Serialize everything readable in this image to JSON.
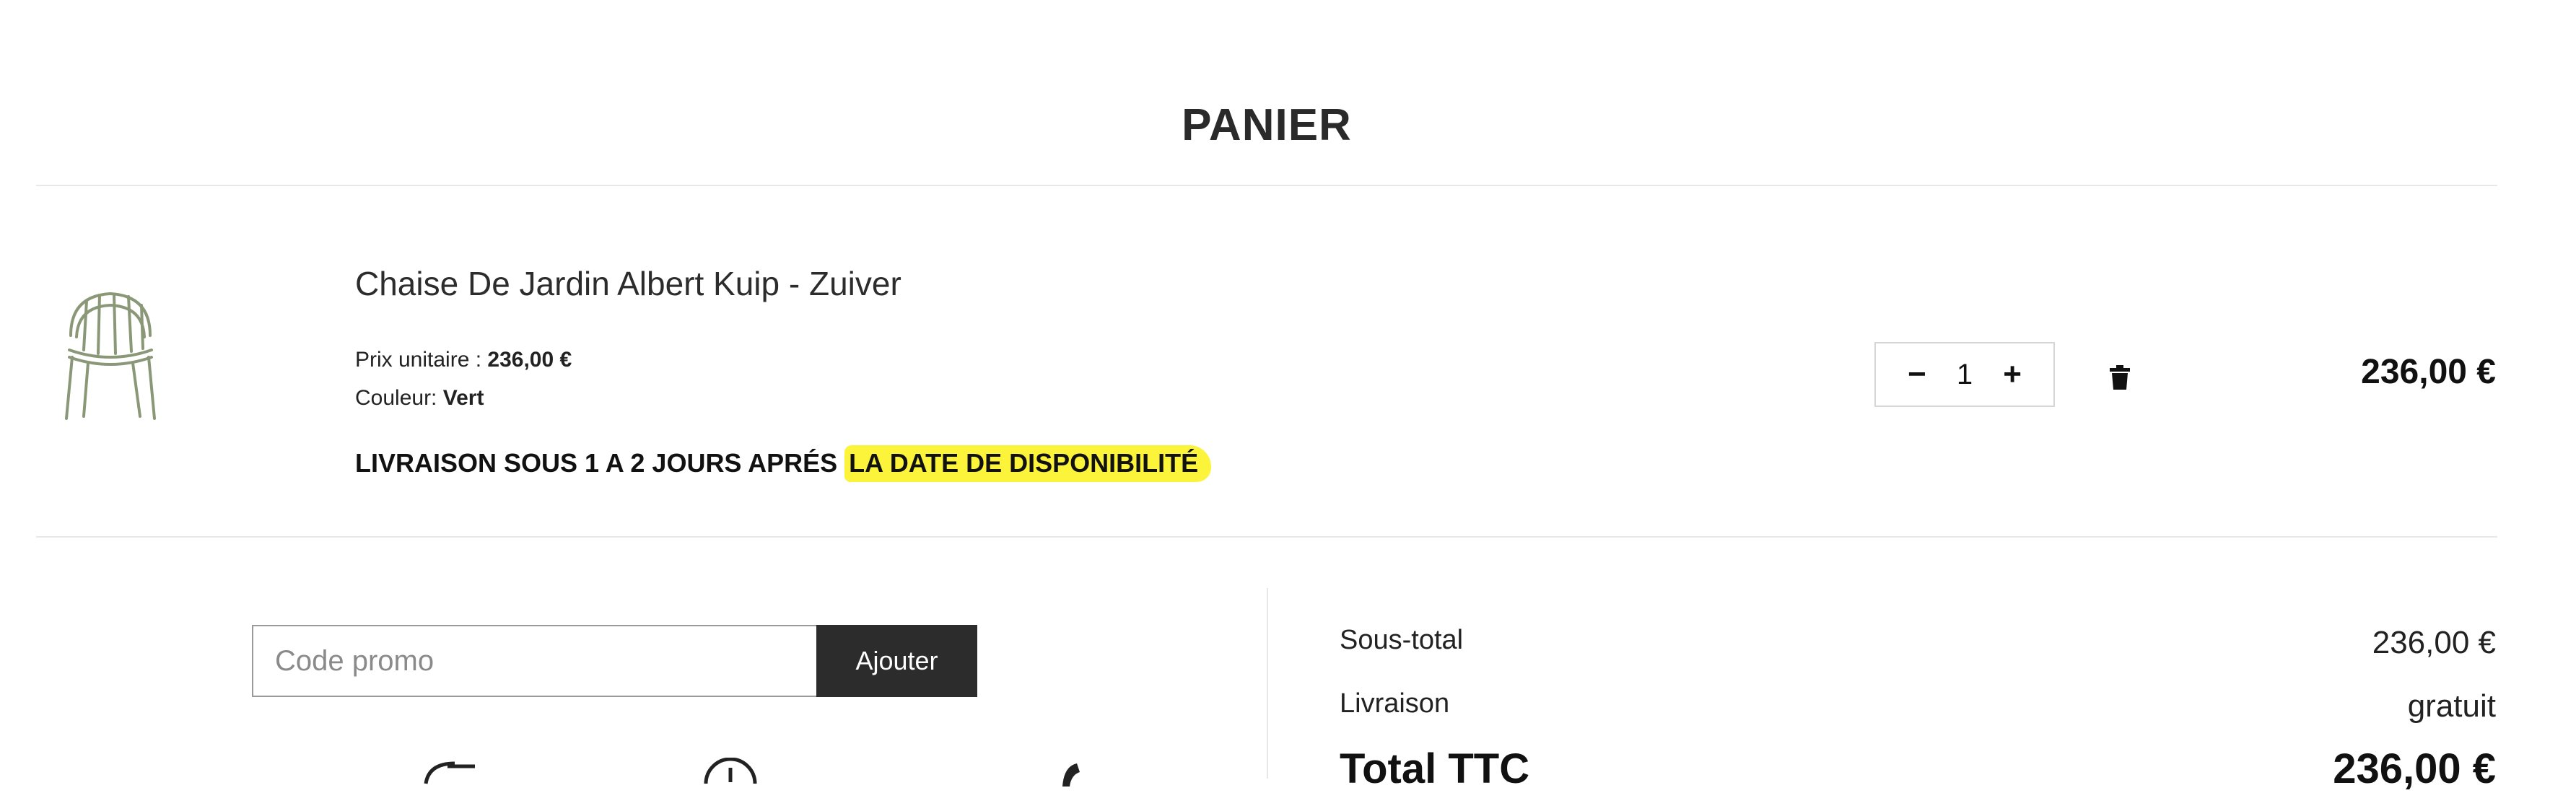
{
  "page": {
    "title": "PANIER"
  },
  "cart_item": {
    "name": "Chaise De Jardin Albert Kuip - Zuiver",
    "unit_price_label": "Prix unitaire : ",
    "unit_price": "236,00 €",
    "color_label": "Couleur: ",
    "color_value": "Vert",
    "delivery_text": "LIVRAISON SOUS 1 A 2 JOURS APRÉS ",
    "delivery_highlight": "LA DATE DE DISPONIBILITÉ",
    "quantity": "1",
    "minus_symbol": "−",
    "plus_symbol": "+",
    "line_total": "236,00 €",
    "image_icon": "chair-icon",
    "delete_icon": "trash-icon"
  },
  "promo": {
    "placeholder": "Code promo",
    "button_label": "Ajouter"
  },
  "totals": {
    "subtotal_label": "Sous-total",
    "subtotal_value": "236,00 €",
    "shipping_label": "Livraison",
    "shipping_value": "gratuit",
    "total_label": "Total TTC",
    "total_value": "236,00 €"
  },
  "colors": {
    "highlight": "#fbf43a",
    "button_bg": "#2c2c2c",
    "chair_green": "#8a9878"
  }
}
